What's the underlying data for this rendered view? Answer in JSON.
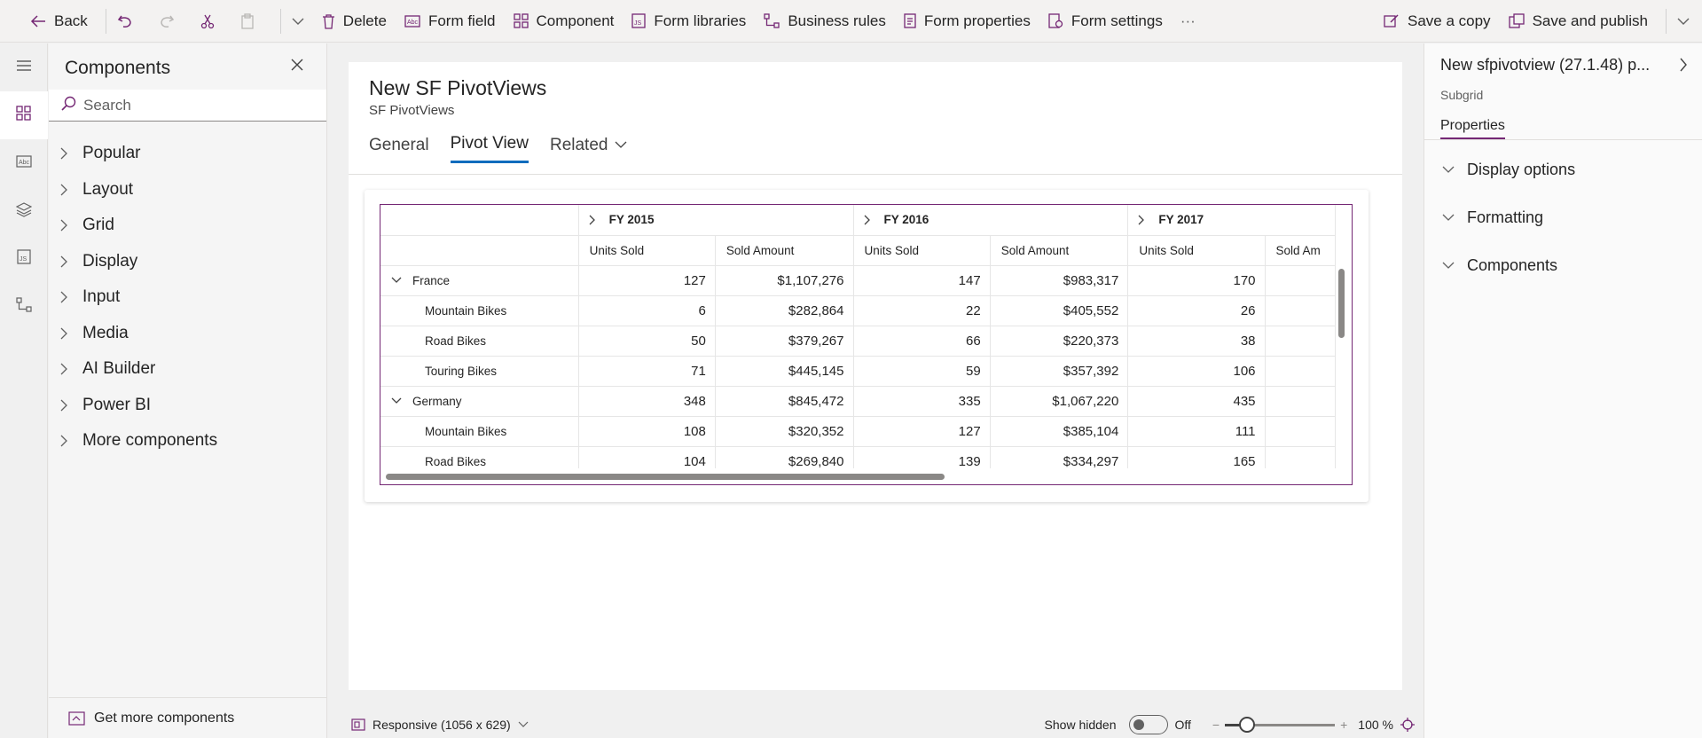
{
  "toolbar": {
    "back": "Back",
    "delete": "Delete",
    "form_field": "Form field",
    "component": "Component",
    "form_libraries": "Form libraries",
    "business_rules": "Business rules",
    "form_properties": "Form properties",
    "form_settings": "Form settings",
    "more": "···",
    "save_copy": "Save a copy",
    "save_publish": "Save and publish"
  },
  "components_panel": {
    "title": "Components",
    "search_placeholder": "Search",
    "categories": [
      "Popular",
      "Layout",
      "Grid",
      "Display",
      "Input",
      "Media",
      "AI Builder",
      "Power BI",
      "More components"
    ],
    "get_more": "Get more components"
  },
  "form": {
    "title": "New SF PivotViews",
    "subtitle": "SF PivotViews",
    "tabs": [
      "General",
      "Pivot View",
      "Related"
    ],
    "active_tab": "Pivot View"
  },
  "pivot": {
    "years": [
      "FY 2015",
      "FY 2016",
      "FY 2017"
    ],
    "measures": [
      "Units Sold",
      "Sold Amount",
      "Units Sold",
      "Sold Amount",
      "Units Sold",
      "Sold Am"
    ],
    "rows": [
      {
        "label": "France",
        "level": 0,
        "values": [
          "127",
          "$1,107,276",
          "147",
          "$983,317",
          "170"
        ]
      },
      {
        "label": "Mountain Bikes",
        "level": 1,
        "values": [
          "6",
          "$282,864",
          "22",
          "$405,552",
          "26"
        ]
      },
      {
        "label": "Road Bikes",
        "level": 1,
        "values": [
          "50",
          "$379,267",
          "66",
          "$220,373",
          "38"
        ]
      },
      {
        "label": "Touring Bikes",
        "level": 1,
        "values": [
          "71",
          "$445,145",
          "59",
          "$357,392",
          "106"
        ]
      },
      {
        "label": "Germany",
        "level": 0,
        "values": [
          "348",
          "$845,472",
          "335",
          "$1,067,220",
          "435"
        ]
      },
      {
        "label": "Mountain Bikes",
        "level": 1,
        "values": [
          "108",
          "$320,352",
          "127",
          "$385,104",
          "111"
        ]
      },
      {
        "label": "Road Bikes",
        "level": 1,
        "values": [
          "104",
          "$269,840",
          "139",
          "$334,297",
          "165"
        ]
      }
    ]
  },
  "properties": {
    "title": "New sfpivotview (27.1.48) p...",
    "subtitle": "Subgrid",
    "tab": "Properties",
    "sections": [
      "Display options",
      "Formatting",
      "Components"
    ]
  },
  "status": {
    "responsive": "Responsive (1056 x 629)",
    "show_hidden": "Show hidden",
    "toggle_state": "Off",
    "zoom": "100 %",
    "zoom_level": 0.2
  },
  "colors": {
    "accent": "#742774",
    "tab_underline": "#0f6cbd"
  }
}
